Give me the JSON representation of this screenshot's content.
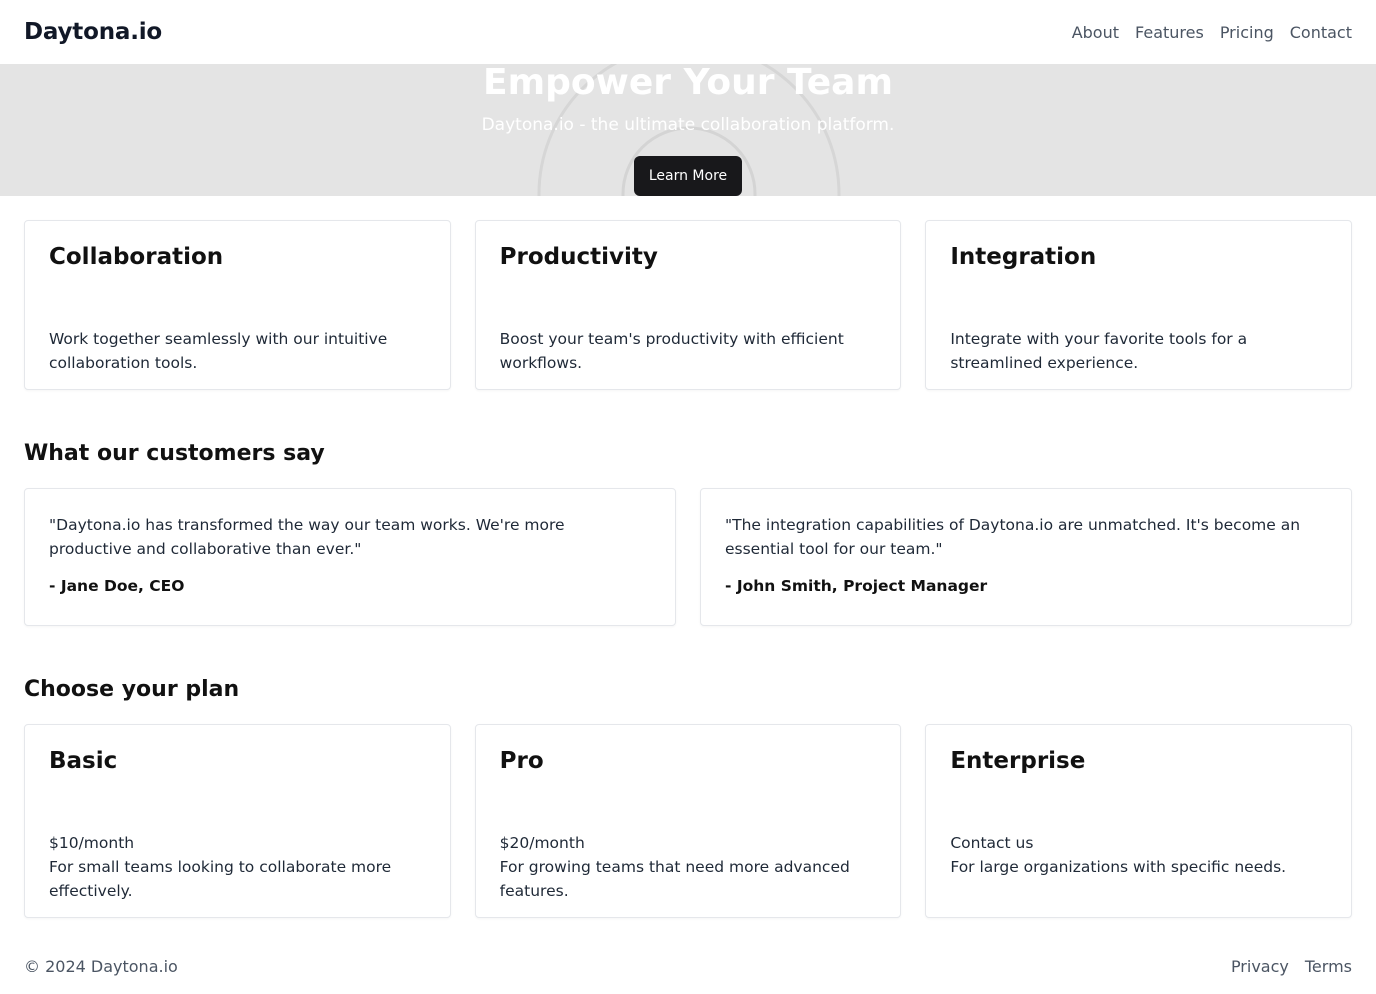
{
  "header": {
    "brand": "Daytona.io",
    "nav": [
      "About",
      "Features",
      "Pricing",
      "Contact"
    ]
  },
  "hero": {
    "title": "Empower Your Team",
    "subtitle": "Daytona.io - the ultimate collaboration platform.",
    "cta_label": "Learn More",
    "image_icon": "image-placeholder-icon"
  },
  "features": [
    {
      "title": "Collaboration",
      "text": "Work together seamlessly with our intuitive collaboration tools."
    },
    {
      "title": "Productivity",
      "text": "Boost your team's productivity with efficient workflows."
    },
    {
      "title": "Integration",
      "text": "Integrate with your favorite tools for a streamlined experience."
    }
  ],
  "testimonials": {
    "title": "What our customers say",
    "items": [
      {
        "quote": "\"Daytona.io has transformed the way our team works. We're more productive and collaborative than ever.\"",
        "author": "- Jane Doe, CEO"
      },
      {
        "quote": "\"The integration capabilities of Daytona.io are unmatched. It's become an essential tool for our team.\"",
        "author": "- John Smith, Project Manager"
      }
    ]
  },
  "pricing": {
    "title": "Choose your plan",
    "plans": [
      {
        "name": "Basic",
        "price": "$10/month",
        "description": "For small teams looking to collaborate more effectively."
      },
      {
        "name": "Pro",
        "price": "$20/month",
        "description": "For growing teams that need more advanced features."
      },
      {
        "name": "Enterprise",
        "price": "Contact us",
        "description": "For large organizations with specific needs."
      }
    ]
  },
  "footer": {
    "copyright": "© 2024 Daytona.io",
    "links": [
      "Privacy",
      "Terms"
    ]
  },
  "colors": {
    "hero_bg": "#e4e4e4",
    "button_bg": "#18181b",
    "text": "#111827",
    "muted": "#4b5563",
    "border": "#e5e7eb"
  }
}
